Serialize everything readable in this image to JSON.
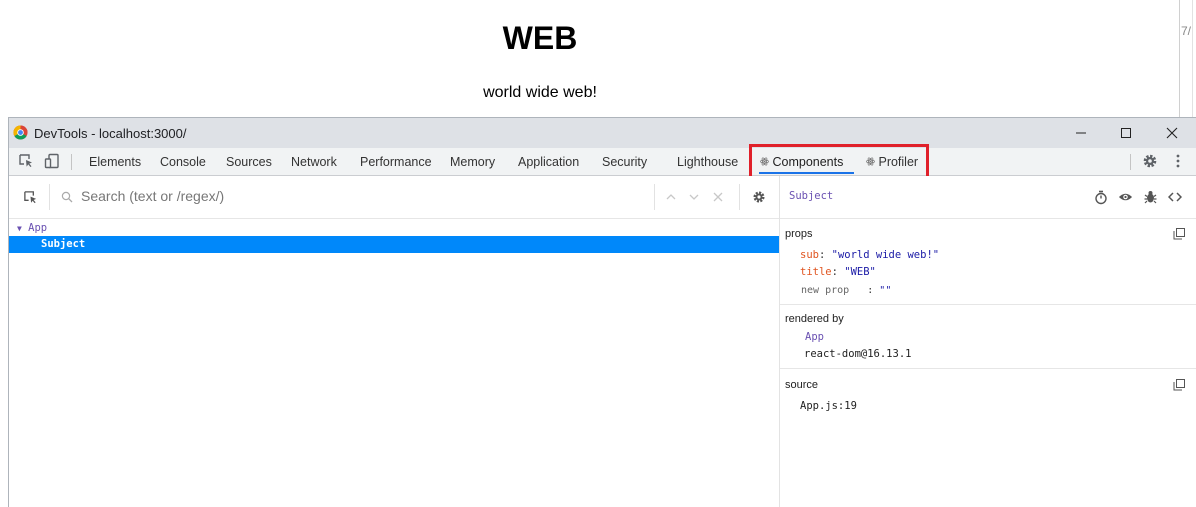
{
  "page": {
    "heading": "WEB",
    "subtitle": "world wide web!",
    "clipped_text": "7/"
  },
  "window": {
    "title": "DevTools - localhost:3000/"
  },
  "tabs": [
    {
      "label": "Elements"
    },
    {
      "label": "Console"
    },
    {
      "label": "Sources"
    },
    {
      "label": "Network"
    },
    {
      "label": "Performance"
    },
    {
      "label": "Memory"
    },
    {
      "label": "Application"
    },
    {
      "label": "Security"
    },
    {
      "label": "Lighthouse"
    },
    {
      "label": "Components",
      "prefix_icon": "react-atom-icon",
      "active": true
    },
    {
      "label": "Profiler",
      "prefix_icon": "react-atom-icon"
    }
  ],
  "search": {
    "placeholder": "Search (text or /regex/)"
  },
  "tree": {
    "root": "App",
    "selected": "Subject"
  },
  "inspector": {
    "component_name": "Subject",
    "props_title": "props",
    "props": [
      {
        "key": "sub",
        "value": "\"world wide web!\""
      },
      {
        "key": "title",
        "value": "\"WEB\""
      }
    ],
    "new_prop": {
      "key": "new prop",
      "sep": ":",
      "value": "\"\""
    },
    "rendered_by_title": "rendered by",
    "rendered_by": [
      "App",
      "react-dom@16.13.1"
    ],
    "source_title": "source",
    "source": "App.js:19"
  },
  "colors": {
    "accent": "#1a73e8",
    "selection": "#0088fa",
    "highlight_box": "#e0202a",
    "prop_key": "#e0541f",
    "prop_value": "#1a1aa6",
    "component": "#6a51b2"
  }
}
